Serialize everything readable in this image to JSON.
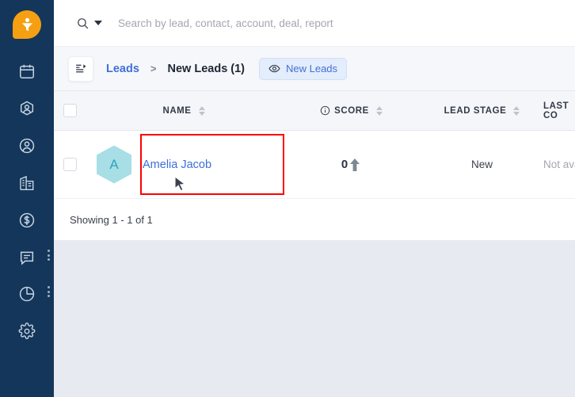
{
  "sidebar": {
    "logo": {
      "name": "funnel-logo",
      "color": "#F5A013"
    },
    "items": [
      {
        "icon": "calendar-icon",
        "label": "Calendar"
      },
      {
        "icon": "leads-icon",
        "label": "Leads"
      },
      {
        "icon": "contacts-icon",
        "label": "Contacts"
      },
      {
        "icon": "accounts-icon",
        "label": "Accounts"
      },
      {
        "icon": "deals-icon",
        "label": "Deals"
      },
      {
        "icon": "conversations-icon",
        "label": "Conversations"
      },
      {
        "icon": "reports-icon",
        "label": "Reports"
      },
      {
        "icon": "settings-icon",
        "label": "Settings"
      }
    ]
  },
  "search": {
    "placeholder": "Search by lead, contact, account, deal, report",
    "value": "",
    "icon": "search-icon",
    "caret": "chevron-down-icon"
  },
  "breadcrumb": {
    "toggle_icon": "list-view-toggle-icon",
    "root": "Leads",
    "separator": ">",
    "current": "New Leads",
    "count": "(1)",
    "view_badge": {
      "icon": "eye-icon",
      "label": "New Leads"
    }
  },
  "table": {
    "columns": [
      {
        "key": "select",
        "label": ""
      },
      {
        "key": "name",
        "label": "NAME",
        "sortable": true
      },
      {
        "key": "score",
        "label": "SCORE",
        "sortable": true,
        "info": true
      },
      {
        "key": "stage",
        "label": "LEAD STAGE",
        "sortable": true
      },
      {
        "key": "last_contacted",
        "label": "LAST CO",
        "sortable": false
      }
    ],
    "rows": [
      {
        "avatar_letter": "A",
        "name": "Amelia Jacob",
        "score": "0",
        "score_trend": "up",
        "stage": "New",
        "last_contacted": "Not ava"
      }
    ],
    "footer": "Showing 1 - 1 of 1"
  },
  "annotation": {
    "color": "#FF0000",
    "target": "Amelia Jacob"
  },
  "colors": {
    "sidebar": "#14365A",
    "accent_orange": "#F5A013",
    "link_blue": "#3B6FD4",
    "badge_bg": "#E3EDFB",
    "page_bg": "#E8EAF2",
    "avatar_bg": "#A8DEE6"
  }
}
